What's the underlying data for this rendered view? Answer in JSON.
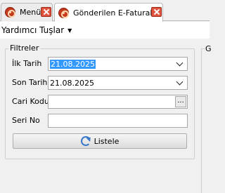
{
  "tabs": [
    {
      "label": "Menü",
      "icon": "menu-app-icon"
    },
    {
      "label": "Gönderilen E-Faturalar",
      "icon": "efatura-app-icon",
      "active": true
    }
  ],
  "menu": {
    "shortcuts_label": "Yardımcı Tuşlar"
  },
  "filters": {
    "title": "Filtreler",
    "ilk_tarih": {
      "label": "İlk Tarih",
      "value": "21.08.2025"
    },
    "son_tarih": {
      "label": "Son Tarih",
      "value": "21.08.2025"
    },
    "cari_kodu": {
      "label": "Cari Kodu",
      "value": "",
      "button": "..."
    },
    "seri_no": {
      "label": "Seri No",
      "value": ""
    },
    "list_button": "Listele"
  },
  "side_panel": {
    "title": "G"
  },
  "colors": {
    "selection": "#3399ff",
    "tab_close": "#e0533c",
    "app_icon": "#c43a1e"
  }
}
